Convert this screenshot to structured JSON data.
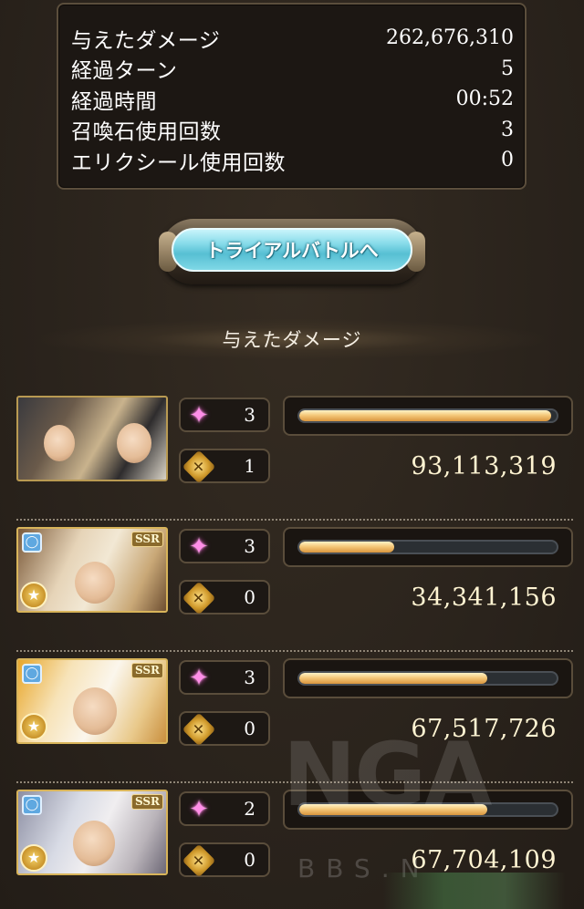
{
  "summary": {
    "rows": [
      {
        "label": "与えたダメージ",
        "value": "262,676,310"
      },
      {
        "label": "経過ターン",
        "value": "5"
      },
      {
        "label": "経過時間",
        "value": "00:52"
      },
      {
        "label": "召喚石使用回数",
        "value": "3"
      },
      {
        "label": "エリクシール使用回数",
        "value": "0"
      }
    ]
  },
  "trial_button": {
    "label": "トライアルバトルへ"
  },
  "section": {
    "heading": "与えたダメージ"
  },
  "characters": [
    {
      "name_icon": "party-portrait",
      "rarity": "",
      "skill_count": "3",
      "ougi_count": "1",
      "damage": "93,113,319",
      "damage_share": 0.98
    },
    {
      "name_icon": "character-portrait",
      "rarity": "SSR",
      "skill_count": "3",
      "ougi_count": "0",
      "damage": "34,341,156",
      "damage_share": 0.37
    },
    {
      "name_icon": "character-portrait",
      "rarity": "SSR",
      "skill_count": "3",
      "ougi_count": "0",
      "damage": "67,517,726",
      "damage_share": 0.73
    },
    {
      "name_icon": "character-portrait",
      "rarity": "SSR",
      "skill_count": "2",
      "ougi_count": "0",
      "damage": "67,704,109",
      "damage_share": 0.73
    }
  ],
  "icons": {
    "skill": "sparkle-icon",
    "ougi": "ougi-icon",
    "element": "ring-icon",
    "emblem": "star-emblem-icon"
  },
  "colors": {
    "background": "#2b241d",
    "bar_fill": "#f5c97a",
    "button": "#86dbe9"
  },
  "watermark": {
    "logo": "NGA",
    "sub": "BBS.N"
  }
}
